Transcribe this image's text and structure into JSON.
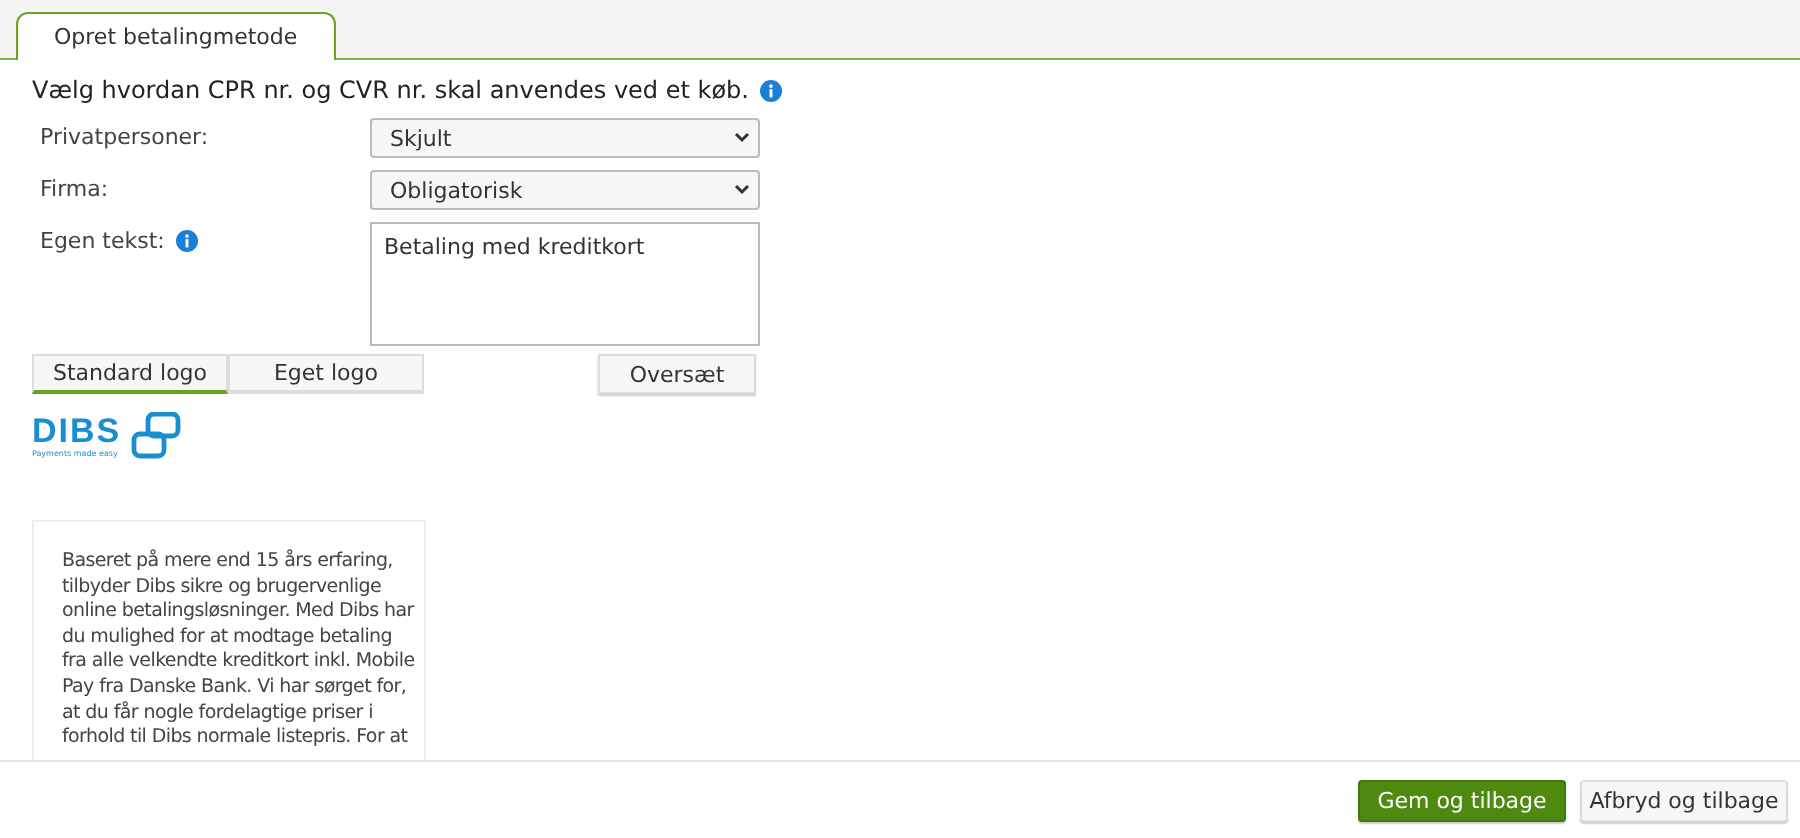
{
  "tabs": [
    {
      "label": "Opret betalingmetode",
      "selected": true
    }
  ],
  "heading": "Vælg hvordan CPR nr. og CVR nr. skal anvendes ved et køb.",
  "fields": [
    {
      "kind": "select",
      "label": "Privatpersoner:",
      "value": "Skjult",
      "info": false
    },
    {
      "kind": "select",
      "label": "Firma:",
      "value": "Obligatorisk",
      "info": false
    },
    {
      "kind": "textarea",
      "label": "Egen tekst:",
      "value": "Betaling med kreditkort",
      "info": true
    }
  ],
  "logo_tabs": [
    {
      "label": "Standard logo",
      "selected": true
    },
    {
      "label": "Eget logo",
      "selected": false
    }
  ],
  "translate_button": "Oversæt",
  "logo": {
    "name": "DIBS",
    "tagline": "Payments made easy"
  },
  "description_lines": [
    "Baseret på mere end 15 års erfaring,",
    "tilbyder Dibs sikre og brugervenlige",
    "online betalingsløsninger. Med Dibs har",
    "du mulighed for at modtage betaling",
    "fra alle velkendte kreditkort inkl. Mobile",
    "Pay fra Danske Bank. Vi har sørget for,",
    "at du får nogle fordelagtige priser i",
    "forhold til Dibs normale listepris. For at"
  ],
  "footer_buttons": [
    {
      "kind": "primary",
      "label": "Gem og tilbage"
    },
    {
      "kind": "secondary",
      "label": "Afbryd og tilbage"
    }
  ]
}
